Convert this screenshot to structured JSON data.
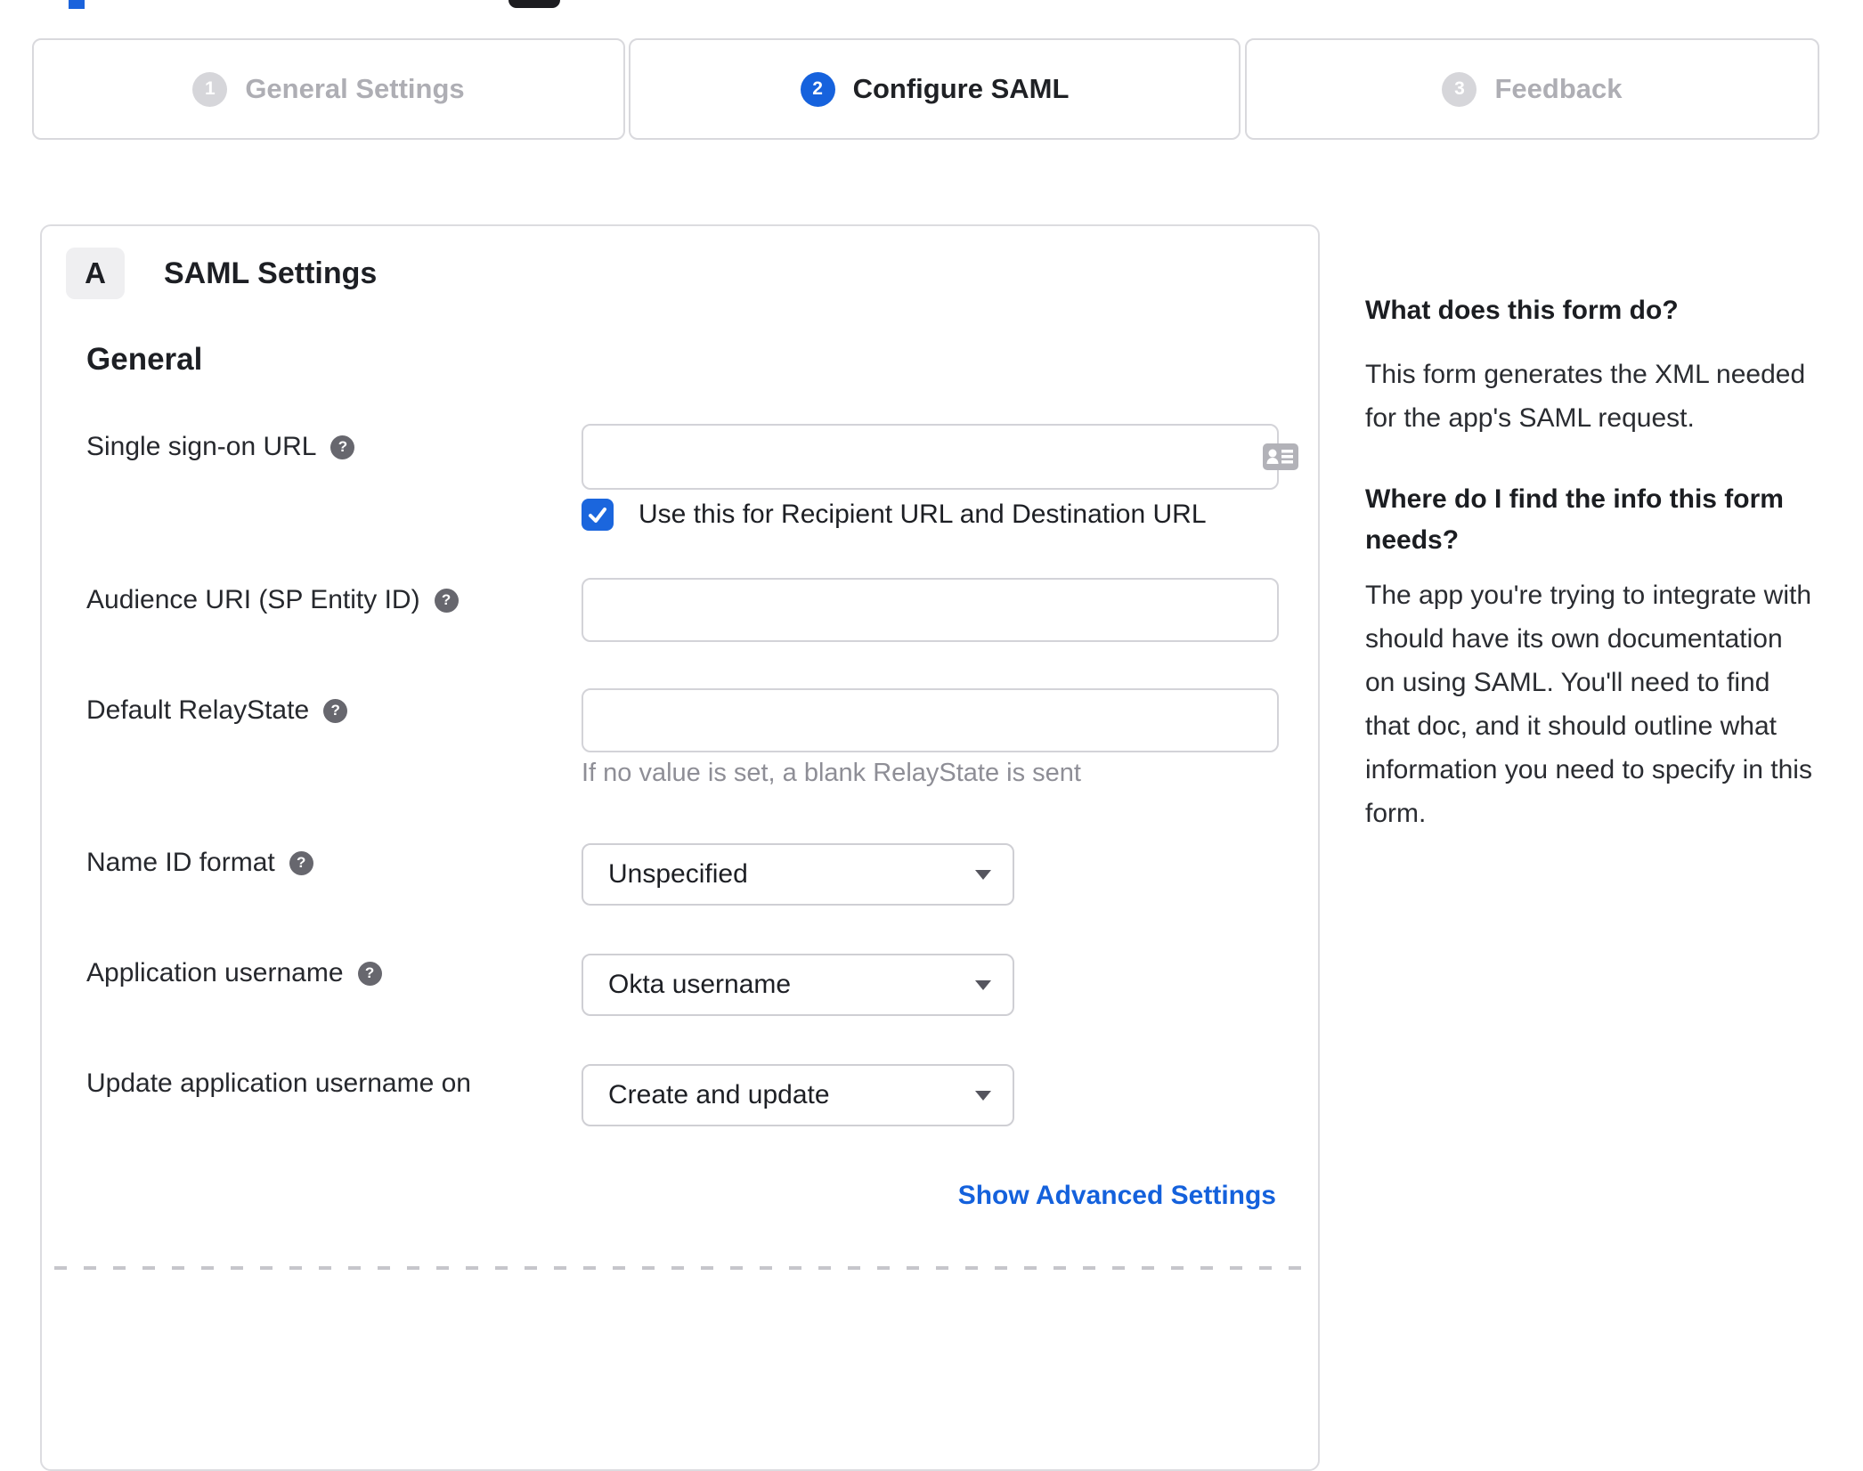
{
  "colors": {
    "accent_blue": "#1662dd",
    "inactive_gray": "#d6d6da",
    "border_gray": "#d9d9dd",
    "hint_gray": "#8e8e96"
  },
  "stepper": {
    "steps": [
      {
        "number": "1",
        "label": "General Settings",
        "state": "inactive"
      },
      {
        "number": "2",
        "label": "Configure SAML",
        "state": "active"
      },
      {
        "number": "3",
        "label": "Feedback",
        "state": "inactive"
      }
    ]
  },
  "panel": {
    "badge": "A",
    "title": "SAML Settings",
    "section_heading": "General",
    "fields": {
      "sso_url": {
        "label": "Single sign-on URL",
        "value": "",
        "icon": "contact-card-icon"
      },
      "sso_checkbox": {
        "label": "Use this for Recipient URL and Destination URL",
        "checked": true
      },
      "audience_uri": {
        "label": "Audience URI (SP Entity ID)",
        "value": ""
      },
      "relay_state": {
        "label": "Default RelayState",
        "value": "",
        "hint": "If no value is set, a blank RelayState is sent"
      },
      "name_id_format": {
        "label": "Name ID format",
        "value": "Unspecified"
      },
      "app_username": {
        "label": "Application username",
        "value": "Okta username"
      },
      "update_app_username": {
        "label": "Update application username on",
        "value": "Create and update"
      }
    },
    "advanced_link": "Show Advanced Settings"
  },
  "sidebar": {
    "q1": "What does this form do?",
    "a1": "This form generates the XML needed for the app's SAML request.",
    "q2": "Where do I find the info this form needs?",
    "a2": "The app you're trying to integrate with should have its own documentation on using SAML. You'll need to find that doc, and it should outline what information you need to specify in this form."
  }
}
